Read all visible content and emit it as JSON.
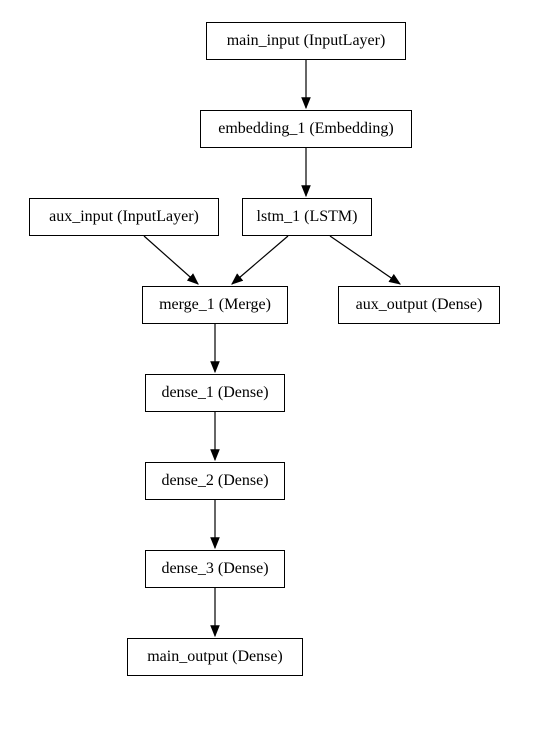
{
  "diagram": {
    "nodes": {
      "main_input": "main_input (InputLayer)",
      "embedding_1": "embedding_1 (Embedding)",
      "aux_input": "aux_input (InputLayer)",
      "lstm_1": "lstm_1 (LSTM)",
      "merge_1": "merge_1 (Merge)",
      "aux_output": "aux_output (Dense)",
      "dense_1": "dense_1 (Dense)",
      "dense_2": "dense_2 (Dense)",
      "dense_3": "dense_3 (Dense)",
      "main_output": "main_output (Dense)"
    },
    "edges": [
      [
        "main_input",
        "embedding_1"
      ],
      [
        "embedding_1",
        "lstm_1"
      ],
      [
        "aux_input",
        "merge_1"
      ],
      [
        "lstm_1",
        "merge_1"
      ],
      [
        "lstm_1",
        "aux_output"
      ],
      [
        "merge_1",
        "dense_1"
      ],
      [
        "dense_1",
        "dense_2"
      ],
      [
        "dense_2",
        "dense_3"
      ],
      [
        "dense_3",
        "main_output"
      ]
    ]
  }
}
